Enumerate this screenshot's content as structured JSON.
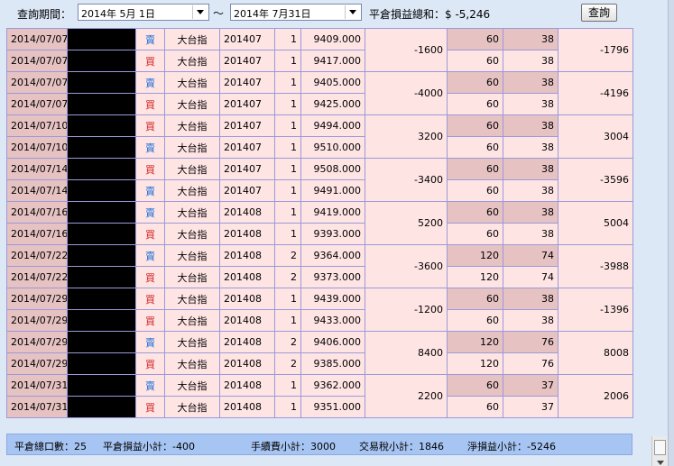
{
  "toolbar": {
    "period_label": "查詢期間：",
    "start_date": "2014年  5月  1日",
    "separator": "～",
    "end_date": "2014年  7月31日",
    "total_label": "平倉損益總和：$ -5,246",
    "query_button": "查詢"
  },
  "trades": [
    {
      "rows": [
        {
          "date": "2014/07/07",
          "side": "賣",
          "side_type": "sell",
          "product": "大台指",
          "month": "201407",
          "qty": "1",
          "price": "9409.000",
          "fee": "60",
          "tax": "38"
        },
        {
          "date": "2014/07/07",
          "side": "買",
          "side_type": "buy",
          "product": "大台指",
          "month": "201407",
          "qty": "1",
          "price": "9417.000",
          "fee": "60",
          "tax": "38"
        }
      ],
      "pnl": "-1600",
      "net": "-1796"
    },
    {
      "rows": [
        {
          "date": "2014/07/07",
          "side": "賣",
          "side_type": "sell",
          "product": "大台指",
          "month": "201407",
          "qty": "1",
          "price": "9405.000",
          "fee": "60",
          "tax": "38"
        },
        {
          "date": "2014/07/07",
          "side": "買",
          "side_type": "buy",
          "product": "大台指",
          "month": "201407",
          "qty": "1",
          "price": "9425.000",
          "fee": "60",
          "tax": "38"
        }
      ],
      "pnl": "-4000",
      "net": "-4196"
    },
    {
      "rows": [
        {
          "date": "2014/07/10",
          "side": "買",
          "side_type": "buy",
          "product": "大台指",
          "month": "201407",
          "qty": "1",
          "price": "9494.000",
          "fee": "60",
          "tax": "38"
        },
        {
          "date": "2014/07/10",
          "side": "賣",
          "side_type": "sell",
          "product": "大台指",
          "month": "201407",
          "qty": "1",
          "price": "9510.000",
          "fee": "60",
          "tax": "38"
        }
      ],
      "pnl": "3200",
      "net": "3004"
    },
    {
      "rows": [
        {
          "date": "2014/07/14",
          "side": "買",
          "side_type": "buy",
          "product": "大台指",
          "month": "201407",
          "qty": "1",
          "price": "9508.000",
          "fee": "60",
          "tax": "38"
        },
        {
          "date": "2014/07/14",
          "side": "賣",
          "side_type": "sell",
          "product": "大台指",
          "month": "201407",
          "qty": "1",
          "price": "9491.000",
          "fee": "60",
          "tax": "38"
        }
      ],
      "pnl": "-3400",
      "net": "-3596"
    },
    {
      "rows": [
        {
          "date": "2014/07/16",
          "side": "賣",
          "side_type": "sell",
          "product": "大台指",
          "month": "201408",
          "qty": "1",
          "price": "9419.000",
          "fee": "60",
          "tax": "38"
        },
        {
          "date": "2014/07/16",
          "side": "買",
          "side_type": "buy",
          "product": "大台指",
          "month": "201408",
          "qty": "1",
          "price": "9393.000",
          "fee": "60",
          "tax": "38"
        }
      ],
      "pnl": "5200",
      "net": "5004"
    },
    {
      "rows": [
        {
          "date": "2014/07/22",
          "side": "賣",
          "side_type": "sell",
          "product": "大台指",
          "month": "201408",
          "qty": "2",
          "price": "9364.000",
          "fee": "120",
          "tax": "74"
        },
        {
          "date": "2014/07/22",
          "side": "買",
          "side_type": "buy",
          "product": "大台指",
          "month": "201408",
          "qty": "2",
          "price": "9373.000",
          "fee": "120",
          "tax": "74"
        }
      ],
      "pnl": "-3600",
      "net": "-3988"
    },
    {
      "rows": [
        {
          "date": "2014/07/29",
          "side": "買",
          "side_type": "buy",
          "product": "大台指",
          "month": "201408",
          "qty": "1",
          "price": "9439.000",
          "fee": "60",
          "tax": "38"
        },
        {
          "date": "2014/07/29",
          "side": "買",
          "side_type": "buy",
          "product": "大台指",
          "month": "201408",
          "qty": "1",
          "price": "9433.000",
          "fee": "60",
          "tax": "38"
        }
      ],
      "pnl": "-1200",
      "net": "-1396"
    },
    {
      "rows": [
        {
          "date": "2014/07/29",
          "side": "賣",
          "side_type": "sell",
          "product": "大台指",
          "month": "201408",
          "qty": "2",
          "price": "9406.000",
          "fee": "120",
          "tax": "76"
        },
        {
          "date": "2014/07/29",
          "side": "買",
          "side_type": "buy",
          "product": "大台指",
          "month": "201408",
          "qty": "2",
          "price": "9385.000",
          "fee": "120",
          "tax": "76"
        }
      ],
      "pnl": "8400",
      "net": "8008"
    },
    {
      "rows": [
        {
          "date": "2014/07/31",
          "side": "賣",
          "side_type": "sell",
          "product": "大台指",
          "month": "201408",
          "qty": "1",
          "price": "9362.000",
          "fee": "60",
          "tax": "37"
        },
        {
          "date": "2014/07/31",
          "side": "買",
          "side_type": "buy",
          "product": "大台指",
          "month": "201408",
          "qty": "1",
          "price": "9351.000",
          "fee": "60",
          "tax": "37"
        }
      ],
      "pnl": "2200",
      "net": "2006"
    }
  ],
  "summary": {
    "total_lots": "平倉總口數：25",
    "pnl_subtotal": "平倉損益小計：-400",
    "fee_subtotal": "手續費小計：3000",
    "tax_subtotal": "交易稅小計：1846",
    "net_subtotal": "淨損益小計：-5246"
  },
  "colors": {
    "sell": "#1e6fd9",
    "buy": "#d02424",
    "cell_bg": "#ffe4e4",
    "date_bg": "#e6c2c2",
    "summary_bg": "#a7c5f3"
  }
}
